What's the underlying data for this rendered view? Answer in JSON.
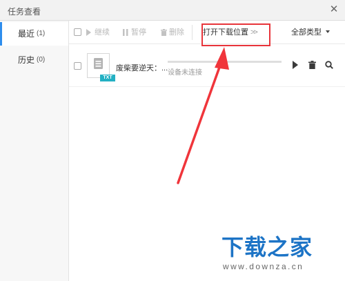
{
  "window": {
    "title": "任务查看"
  },
  "sidebar": {
    "items": [
      {
        "label": "最近",
        "count": "(1)",
        "active": true
      },
      {
        "label": "历史",
        "count": "(0)",
        "active": false
      }
    ]
  },
  "toolbar": {
    "continue_label": "继续",
    "pause_label": "暂停",
    "delete_label": "删除",
    "open_location_label": "打开下载位置",
    "open_location_arrows": ">>",
    "type_filter_label": "全部类型"
  },
  "tasks": [
    {
      "file_name": "废柴要逆天：...",
      "file_type": "TXT",
      "status": "设备未连接",
      "progress": 0
    }
  ],
  "watermark": {
    "title": "下载之家",
    "url": "www.downza.cn"
  },
  "colors": {
    "accent": "#2e8ded",
    "highlight": "#e8343a",
    "annotation_arrow": "#f0353b",
    "file_badge": "#23b0c3",
    "watermark_blue": "#1d74c6"
  },
  "icons": {
    "close": "close-icon",
    "continue": "play-icon",
    "pause": "pause-icon",
    "delete": "trash-icon",
    "file": "document-icon",
    "dropdown": "caret-down-icon",
    "row_play": "play-icon",
    "row_delete": "trash-icon",
    "row_search": "search-icon"
  }
}
